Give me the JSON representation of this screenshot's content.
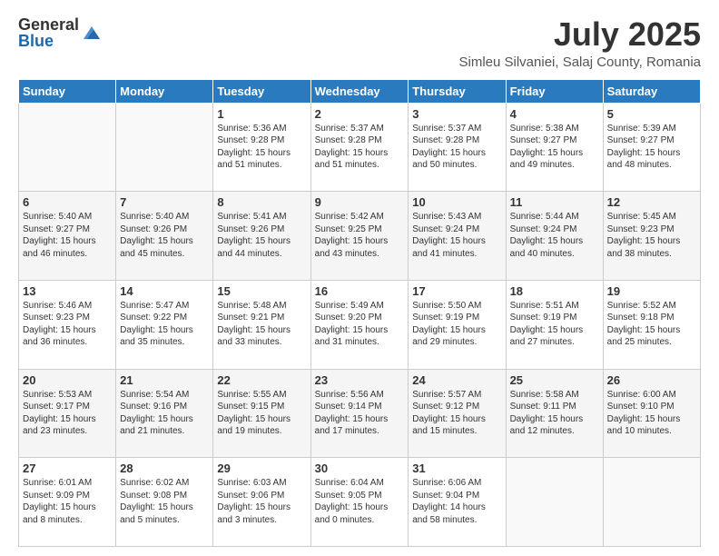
{
  "logo": {
    "general": "General",
    "blue": "Blue"
  },
  "title": "July 2025",
  "location": "Simleu Silvaniei, Salaj County, Romania",
  "header_days": [
    "Sunday",
    "Monday",
    "Tuesday",
    "Wednesday",
    "Thursday",
    "Friday",
    "Saturday"
  ],
  "weeks": [
    [
      {
        "day": "",
        "sunrise": "",
        "sunset": "",
        "daylight": ""
      },
      {
        "day": "",
        "sunrise": "",
        "sunset": "",
        "daylight": ""
      },
      {
        "day": "1",
        "sunrise": "Sunrise: 5:36 AM",
        "sunset": "Sunset: 9:28 PM",
        "daylight": "Daylight: 15 hours and 51 minutes."
      },
      {
        "day": "2",
        "sunrise": "Sunrise: 5:37 AM",
        "sunset": "Sunset: 9:28 PM",
        "daylight": "Daylight: 15 hours and 51 minutes."
      },
      {
        "day": "3",
        "sunrise": "Sunrise: 5:37 AM",
        "sunset": "Sunset: 9:28 PM",
        "daylight": "Daylight: 15 hours and 50 minutes."
      },
      {
        "day": "4",
        "sunrise": "Sunrise: 5:38 AM",
        "sunset": "Sunset: 9:27 PM",
        "daylight": "Daylight: 15 hours and 49 minutes."
      },
      {
        "day": "5",
        "sunrise": "Sunrise: 5:39 AM",
        "sunset": "Sunset: 9:27 PM",
        "daylight": "Daylight: 15 hours and 48 minutes."
      }
    ],
    [
      {
        "day": "6",
        "sunrise": "Sunrise: 5:40 AM",
        "sunset": "Sunset: 9:27 PM",
        "daylight": "Daylight: 15 hours and 46 minutes."
      },
      {
        "day": "7",
        "sunrise": "Sunrise: 5:40 AM",
        "sunset": "Sunset: 9:26 PM",
        "daylight": "Daylight: 15 hours and 45 minutes."
      },
      {
        "day": "8",
        "sunrise": "Sunrise: 5:41 AM",
        "sunset": "Sunset: 9:26 PM",
        "daylight": "Daylight: 15 hours and 44 minutes."
      },
      {
        "day": "9",
        "sunrise": "Sunrise: 5:42 AM",
        "sunset": "Sunset: 9:25 PM",
        "daylight": "Daylight: 15 hours and 43 minutes."
      },
      {
        "day": "10",
        "sunrise": "Sunrise: 5:43 AM",
        "sunset": "Sunset: 9:24 PM",
        "daylight": "Daylight: 15 hours and 41 minutes."
      },
      {
        "day": "11",
        "sunrise": "Sunrise: 5:44 AM",
        "sunset": "Sunset: 9:24 PM",
        "daylight": "Daylight: 15 hours and 40 minutes."
      },
      {
        "day": "12",
        "sunrise": "Sunrise: 5:45 AM",
        "sunset": "Sunset: 9:23 PM",
        "daylight": "Daylight: 15 hours and 38 minutes."
      }
    ],
    [
      {
        "day": "13",
        "sunrise": "Sunrise: 5:46 AM",
        "sunset": "Sunset: 9:23 PM",
        "daylight": "Daylight: 15 hours and 36 minutes."
      },
      {
        "day": "14",
        "sunrise": "Sunrise: 5:47 AM",
        "sunset": "Sunset: 9:22 PM",
        "daylight": "Daylight: 15 hours and 35 minutes."
      },
      {
        "day": "15",
        "sunrise": "Sunrise: 5:48 AM",
        "sunset": "Sunset: 9:21 PM",
        "daylight": "Daylight: 15 hours and 33 minutes."
      },
      {
        "day": "16",
        "sunrise": "Sunrise: 5:49 AM",
        "sunset": "Sunset: 9:20 PM",
        "daylight": "Daylight: 15 hours and 31 minutes."
      },
      {
        "day": "17",
        "sunrise": "Sunrise: 5:50 AM",
        "sunset": "Sunset: 9:19 PM",
        "daylight": "Daylight: 15 hours and 29 minutes."
      },
      {
        "day": "18",
        "sunrise": "Sunrise: 5:51 AM",
        "sunset": "Sunset: 9:19 PM",
        "daylight": "Daylight: 15 hours and 27 minutes."
      },
      {
        "day": "19",
        "sunrise": "Sunrise: 5:52 AM",
        "sunset": "Sunset: 9:18 PM",
        "daylight": "Daylight: 15 hours and 25 minutes."
      }
    ],
    [
      {
        "day": "20",
        "sunrise": "Sunrise: 5:53 AM",
        "sunset": "Sunset: 9:17 PM",
        "daylight": "Daylight: 15 hours and 23 minutes."
      },
      {
        "day": "21",
        "sunrise": "Sunrise: 5:54 AM",
        "sunset": "Sunset: 9:16 PM",
        "daylight": "Daylight: 15 hours and 21 minutes."
      },
      {
        "day": "22",
        "sunrise": "Sunrise: 5:55 AM",
        "sunset": "Sunset: 9:15 PM",
        "daylight": "Daylight: 15 hours and 19 minutes."
      },
      {
        "day": "23",
        "sunrise": "Sunrise: 5:56 AM",
        "sunset": "Sunset: 9:14 PM",
        "daylight": "Daylight: 15 hours and 17 minutes."
      },
      {
        "day": "24",
        "sunrise": "Sunrise: 5:57 AM",
        "sunset": "Sunset: 9:12 PM",
        "daylight": "Daylight: 15 hours and 15 minutes."
      },
      {
        "day": "25",
        "sunrise": "Sunrise: 5:58 AM",
        "sunset": "Sunset: 9:11 PM",
        "daylight": "Daylight: 15 hours and 12 minutes."
      },
      {
        "day": "26",
        "sunrise": "Sunrise: 6:00 AM",
        "sunset": "Sunset: 9:10 PM",
        "daylight": "Daylight: 15 hours and 10 minutes."
      }
    ],
    [
      {
        "day": "27",
        "sunrise": "Sunrise: 6:01 AM",
        "sunset": "Sunset: 9:09 PM",
        "daylight": "Daylight: 15 hours and 8 minutes."
      },
      {
        "day": "28",
        "sunrise": "Sunrise: 6:02 AM",
        "sunset": "Sunset: 9:08 PM",
        "daylight": "Daylight: 15 hours and 5 minutes."
      },
      {
        "day": "29",
        "sunrise": "Sunrise: 6:03 AM",
        "sunset": "Sunset: 9:06 PM",
        "daylight": "Daylight: 15 hours and 3 minutes."
      },
      {
        "day": "30",
        "sunrise": "Sunrise: 6:04 AM",
        "sunset": "Sunset: 9:05 PM",
        "daylight": "Daylight: 15 hours and 0 minutes."
      },
      {
        "day": "31",
        "sunrise": "Sunrise: 6:06 AM",
        "sunset": "Sunset: 9:04 PM",
        "daylight": "Daylight: 14 hours and 58 minutes."
      },
      {
        "day": "",
        "sunrise": "",
        "sunset": "",
        "daylight": ""
      },
      {
        "day": "",
        "sunrise": "",
        "sunset": "",
        "daylight": ""
      }
    ]
  ]
}
